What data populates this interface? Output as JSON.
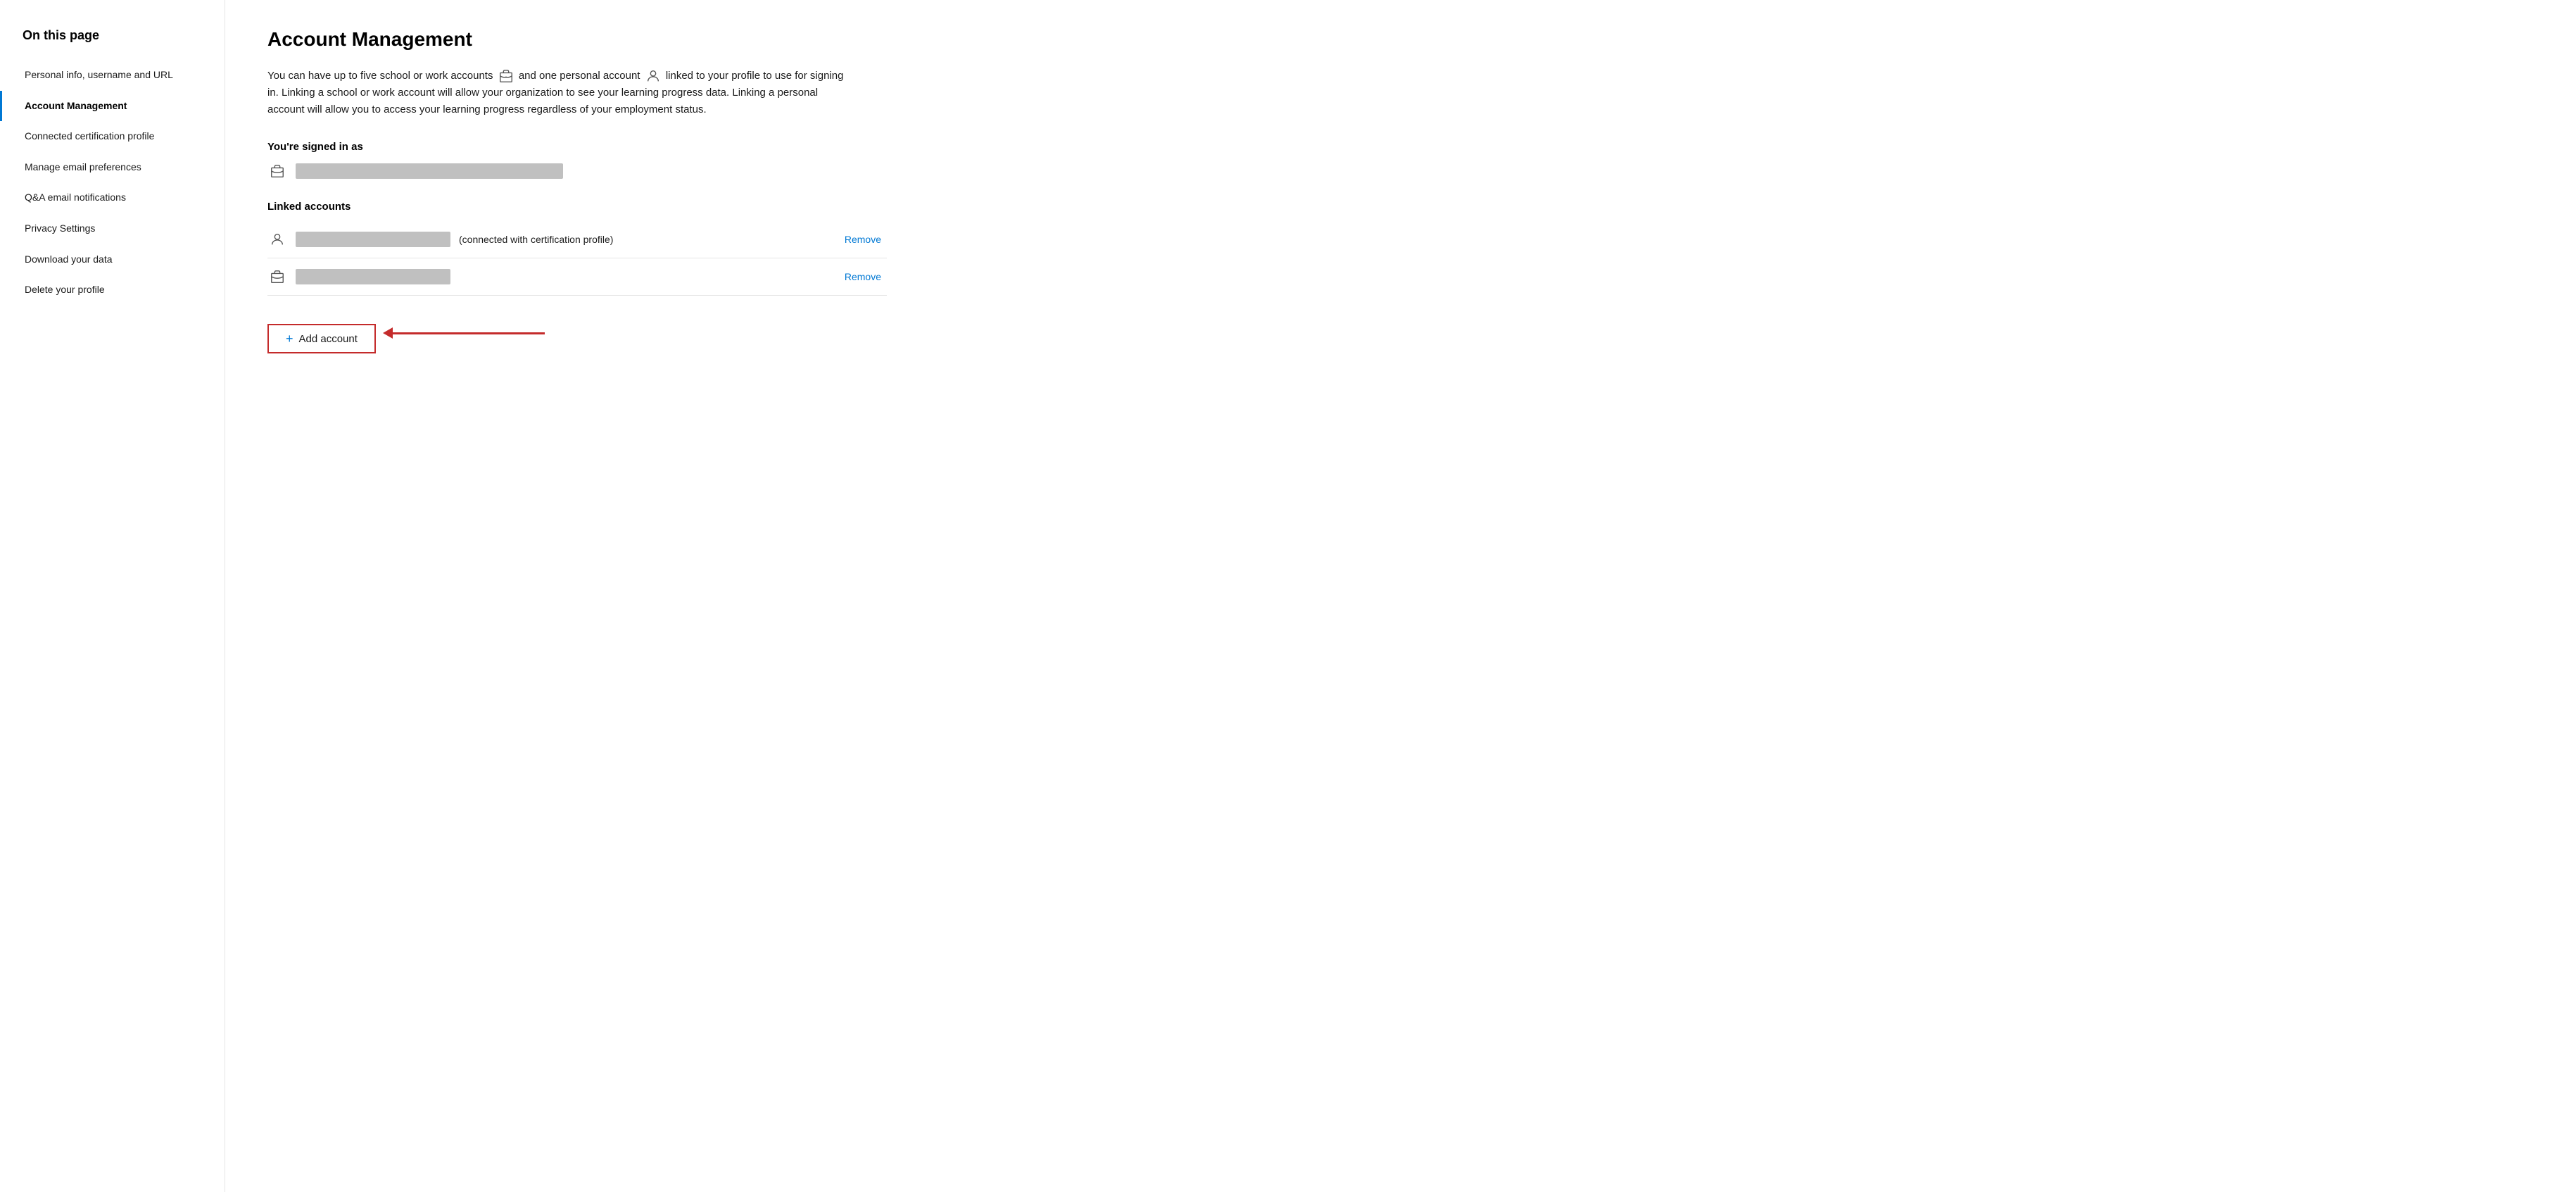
{
  "sidebar": {
    "heading": "On this page",
    "items": [
      {
        "id": "personal-info",
        "label": "Personal info, username and URL",
        "active": false
      },
      {
        "id": "account-management",
        "label": "Account Management",
        "active": true
      },
      {
        "id": "connected-certification",
        "label": "Connected certification profile",
        "active": false
      },
      {
        "id": "manage-email",
        "label": "Manage email preferences",
        "active": false
      },
      {
        "id": "qa-email",
        "label": "Q&A email notifications",
        "active": false
      },
      {
        "id": "privacy-settings",
        "label": "Privacy Settings",
        "active": false
      },
      {
        "id": "download-data",
        "label": "Download your data",
        "active": false
      },
      {
        "id": "delete-profile",
        "label": "Delete your profile",
        "active": false
      }
    ]
  },
  "main": {
    "title": "Account Management",
    "description_part1": "You can have up to five school or work accounts",
    "description_part2": "and one personal account",
    "description_part3": "linked to your profile to use for signing in. Linking a school or work account will allow your organization to see your learning progress data. Linking a personal account will allow you to access your learning progress regardless of your employment status.",
    "signed_in_label": "You're signed in as",
    "linked_accounts_label": "Linked accounts",
    "linked_account_1_cert_text": "(connected with certification profile)",
    "remove_label": "Remove",
    "add_account_label": "Add account"
  }
}
